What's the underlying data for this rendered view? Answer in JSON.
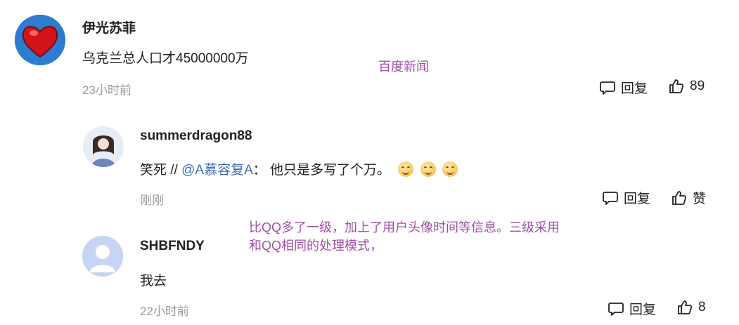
{
  "comments": [
    {
      "user": "伊光苏菲",
      "text": "乌克兰总人口才45000000万",
      "time": "23小时前",
      "reply_label": "回复",
      "like_label": "89"
    },
    {
      "user": "summerdragon88",
      "text_prefix": "笑死 // ",
      "mention": "@A慕容复A",
      "text_suffix": "：  他只是多写了个万。",
      "time": "刚刚",
      "reply_label": "回复",
      "like_label": "赞"
    },
    {
      "user": "SHBFNDY",
      "text": "我去",
      "time": "22小时前",
      "reply_label": "回复",
      "like_label": "8"
    }
  ],
  "annotations": {
    "source": "百度新闻",
    "note_line1": "比QQ多了一级，加上了用户头像时间等信息。三级采用",
    "note_line2": "和QQ相同的处理模式，"
  },
  "colors": {
    "mention": "#3e69b8",
    "annotation": "#a04fa6",
    "timestamp": "#9a9a9a"
  },
  "icons": [
    "comment-bubble-icon",
    "thumbs-up-icon",
    "smile-emoji-icon",
    "heart-avatar",
    "default-avatar-icon"
  ]
}
